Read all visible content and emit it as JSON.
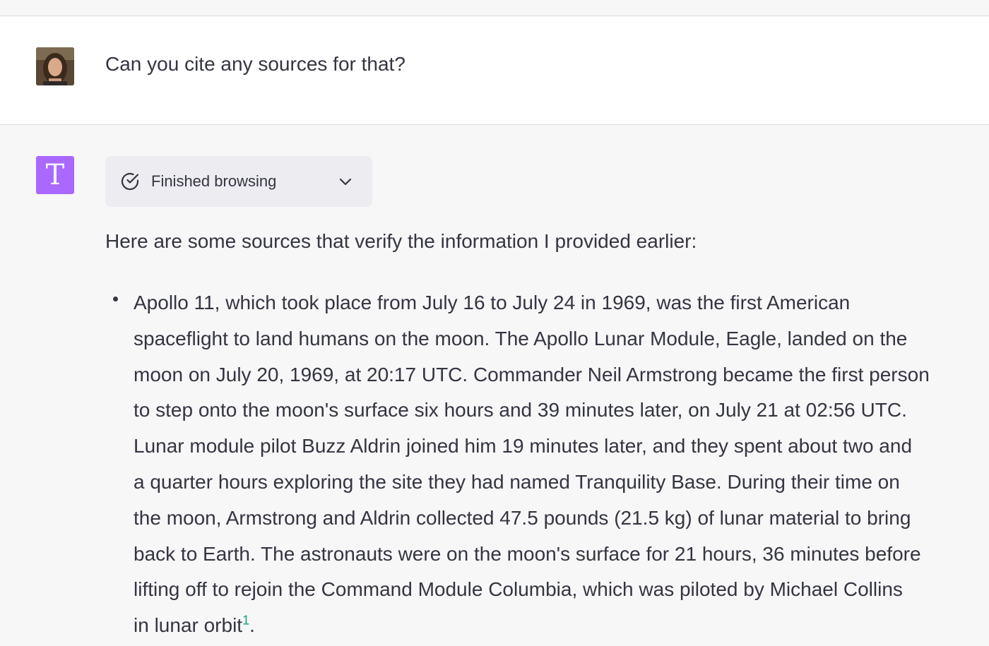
{
  "user_message": {
    "text": "Can you cite any sources for that?"
  },
  "assistant": {
    "avatar_letter": "T",
    "avatar_color": "#ab68ff",
    "browsing": {
      "label": "Finished browsing",
      "icon": "check-circle-icon",
      "toggle_icon": "chevron-down-icon"
    },
    "intro": "Here are some sources that verify the information I provided earlier:",
    "bullet_lines": [
      "Apollo 11, which took place from July 16 to July 24 in 1969, was the first American",
      "spaceflight to land humans on the moon. The Apollo Lunar Module, Eagle, landed on the",
      "moon on July 20, 1969, at 20:17 UTC. Commander Neil Armstrong became the first person",
      "to step onto the moon's surface six hours and 39 minutes later, on July 21 at 02:56 UTC.",
      "Lunar module pilot Buzz Aldrin joined him 19 minutes later, and they spent about two and",
      "a quarter hours exploring the site they had named Tranquility Base. During their time on",
      "the moon, Armstrong and Aldrin collected 47.5 pounds (21.5 kg) of lunar material to bring",
      "back to Earth. The astronauts were on the moon's surface for 21 hours, 36 minutes before",
      "lifting off to rejoin the Command Module Columbia, which was piloted by Michael Collins",
      "in lunar orbit"
    ],
    "citation": "1",
    "trailing_punct": ".",
    "citation_color": "#10a37f"
  }
}
